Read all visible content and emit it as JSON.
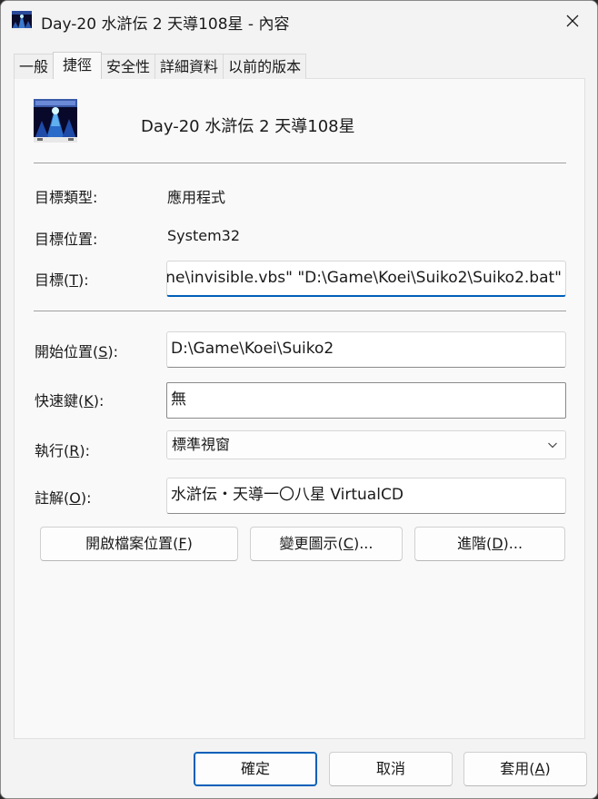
{
  "window": {
    "title": "Day-20 水滸伝 2 天導108星 - 內容"
  },
  "tabs": [
    {
      "label": "一般",
      "active": false
    },
    {
      "label": "捷徑",
      "active": true
    },
    {
      "label": "安全性",
      "active": false
    },
    {
      "label": "詳細資料",
      "active": false
    },
    {
      "label": "以前的版本",
      "active": false
    }
  ],
  "shortcut": {
    "name": "Day-20 水滸伝 2 天導108星",
    "target_type_label": "目標類型:",
    "target_type_value": "應用程式",
    "target_location_label": "目標位置:",
    "target_location_value": "System32",
    "target_label_pre": "目標(",
    "target_label_key": "T",
    "target_label_post": "):",
    "target_value": "ne\\invisible.vbs\" \"D:\\Game\\Koei\\Suiko2\\Suiko2.bat\"",
    "start_in_label_pre": "開始位置(",
    "start_in_label_key": "S",
    "start_in_label_post": "):",
    "start_in_value": "D:\\Game\\Koei\\Suiko2",
    "hotkey_label_pre": "快速鍵(",
    "hotkey_label_key": "K",
    "hotkey_label_post": "):",
    "hotkey_value": "無",
    "run_label_pre": "執行(",
    "run_label_key": "R",
    "run_label_post": "):",
    "run_value": "標準視窗",
    "comment_label_pre": "註解(",
    "comment_label_key": "O",
    "comment_label_post": "):",
    "comment_value": "水滸伝・天導一〇八星 VirtualCD"
  },
  "actions": {
    "open_location_pre": "開啟檔案位置(",
    "open_location_key": "F",
    "open_location_post": ")",
    "change_icon_pre": "變更圖示(",
    "change_icon_key": "C",
    "change_icon_post": ")...",
    "advanced_pre": "進階(",
    "advanced_key": "D",
    "advanced_post": ")..."
  },
  "footer": {
    "ok": "確定",
    "cancel": "取消",
    "apply_pre": "套用(",
    "apply_key": "A",
    "apply_post": ")"
  },
  "colors": {
    "accent": "#005fb8",
    "window_bg": "#f3f3f3",
    "panel_bg": "#f9f9f9"
  }
}
